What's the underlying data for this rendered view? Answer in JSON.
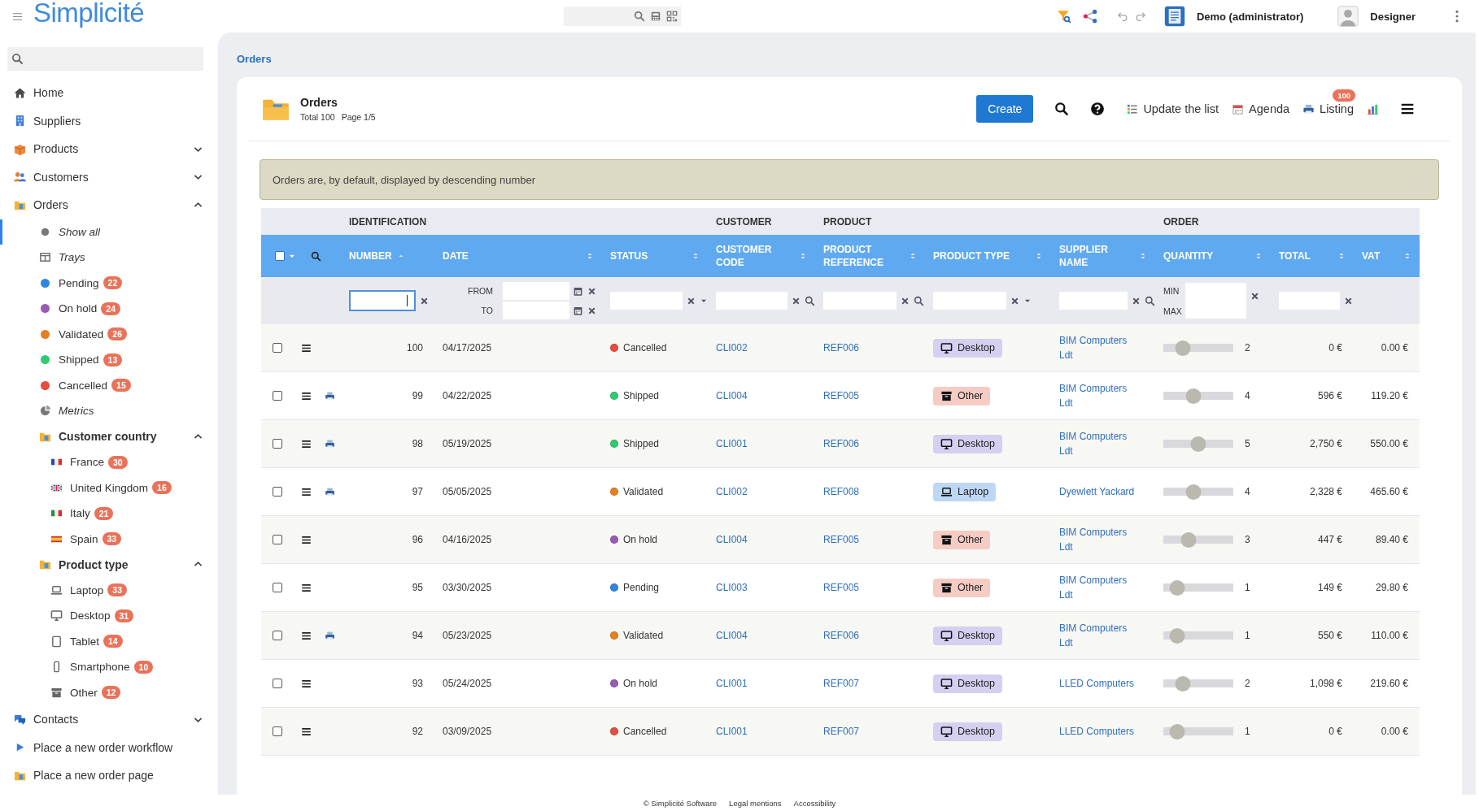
{
  "header": {
    "logo": "Simplicité",
    "user_role": "Demo (administrator)",
    "user_name": "Designer"
  },
  "sidebar": {
    "items": [
      {
        "label": "Home",
        "kind": "link",
        "selected": false
      },
      {
        "label": "Suppliers",
        "kind": "link",
        "selected": false
      },
      {
        "label": "Products",
        "kind": "link",
        "selected": false,
        "expanded": false
      },
      {
        "label": "Customers",
        "kind": "link",
        "selected": false,
        "expanded": false
      },
      {
        "label": "Orders",
        "kind": "link",
        "selected": false,
        "expanded": true,
        "children": [
          {
            "label": "Show all",
            "kind": "view",
            "selected": true
          },
          {
            "label": "Trays",
            "kind": "view",
            "selected": false
          },
          {
            "label": "Pending",
            "kind": "status",
            "selected": false,
            "color": "#2e86de",
            "count": "22"
          },
          {
            "label": "On hold",
            "kind": "status",
            "selected": false,
            "color": "#9b59b6",
            "count": "24"
          },
          {
            "label": "Validated",
            "kind": "status",
            "selected": false,
            "color": "#e67e22",
            "count": "26"
          },
          {
            "label": "Shipped",
            "kind": "status",
            "selected": false,
            "color": "#2ecc71",
            "count": "13"
          },
          {
            "label": "Cancelled",
            "kind": "status",
            "selected": false,
            "color": "#e74c3c",
            "count": "15"
          },
          {
            "label": "Metrics",
            "kind": "view",
            "selected": false
          },
          {
            "label": "Customer country",
            "kind": "group",
            "selected": false,
            "expanded": true,
            "children": [
              {
                "label": "France",
                "kind": "flag",
                "selected": false,
                "count": "30"
              },
              {
                "label": "United Kingdom",
                "kind": "flag",
                "selected": false,
                "count": "16"
              },
              {
                "label": "Italy",
                "kind": "flag",
                "selected": false,
                "count": "21"
              },
              {
                "label": "Spain",
                "kind": "flag",
                "selected": false,
                "count": "33"
              }
            ]
          },
          {
            "label": "Product type",
            "kind": "group",
            "selected": false,
            "expanded": true,
            "children": [
              {
                "label": "Laptop",
                "kind": "device",
                "selected": false,
                "count": "33"
              },
              {
                "label": "Desktop",
                "kind": "device",
                "selected": false,
                "count": "31"
              },
              {
                "label": "Tablet",
                "kind": "device",
                "selected": false,
                "count": "14"
              },
              {
                "label": "Smartphone",
                "kind": "device",
                "selected": false,
                "count": "10"
              },
              {
                "label": "Other",
                "kind": "device",
                "selected": false,
                "count": "12"
              }
            ]
          }
        ]
      },
      {
        "label": "Contacts",
        "kind": "link",
        "selected": false,
        "expanded": false
      },
      {
        "label": "Place a new order workflow",
        "kind": "link",
        "selected": false
      },
      {
        "label": "Place a new order page",
        "kind": "link",
        "selected": false
      }
    ]
  },
  "breadcrumb": "Orders",
  "list": {
    "title": "Orders",
    "total": "Total 100",
    "page": "Page 1/5",
    "actions": {
      "create": "Create",
      "update": "Update the list",
      "agenda": "Agenda",
      "listing": "Listing",
      "listing_badge": "100"
    },
    "notice": "Orders are, by default, displayed by descending number",
    "select_all": {
      "checked": false
    },
    "groups": [
      {
        "label": "IDENTIFICATION"
      },
      {
        "label": "CUSTOMER"
      },
      {
        "label": "PRODUCT"
      },
      {
        "label": "ORDER"
      }
    ],
    "columns": [
      {
        "label": "NUMBER",
        "sorted": true
      },
      {
        "label": "DATE",
        "sorted": false
      },
      {
        "label": "STATUS",
        "sorted": false
      },
      {
        "label": "CUSTOMER CODE",
        "sorted": false
      },
      {
        "label": "PRODUCT REFERENCE",
        "sorted": false
      },
      {
        "label": "PRODUCT TYPE",
        "sorted": false
      },
      {
        "label": "SUPPLIER NAME",
        "sorted": false
      },
      {
        "label": "QUANTITY",
        "sorted": false
      },
      {
        "label": "TOTAL",
        "sorted": false
      },
      {
        "label": "VAT",
        "sorted": false
      }
    ],
    "filters": [
      {
        "kind": "text",
        "focused": true
      },
      {
        "kind": "date-range",
        "from_label": "FROM",
        "to_label": "TO"
      },
      {
        "kind": "select"
      },
      {
        "kind": "lookup"
      },
      {
        "kind": "lookup"
      },
      {
        "kind": "select"
      },
      {
        "kind": "lookup"
      },
      {
        "kind": "range",
        "min_label": "MIN",
        "max_label": "MAX"
      },
      {
        "kind": "text",
        "focused": false
      },
      {
        "kind": "none"
      }
    ],
    "rows": [
      {
        "checked": false,
        "printable": false,
        "number": "100",
        "date": "04/17/2025",
        "status": {
          "label": "Cancelled",
          "color": "#e74c3c"
        },
        "customer": "CLI002",
        "product": "REF006",
        "type": {
          "label": "Desktop",
          "kind": "desktop",
          "color": "#d5cff0"
        },
        "supplier": "BIM Computers Ldt",
        "level": 0.28,
        "quantity": "2",
        "total": "0 €",
        "vat": "0.00 €"
      },
      {
        "checked": false,
        "printable": true,
        "number": "99",
        "date": "04/22/2025",
        "status": {
          "label": "Shipped",
          "color": "#2ecc71"
        },
        "customer": "CLI004",
        "product": "REF005",
        "type": {
          "label": "Other",
          "kind": "other",
          "color": "#f5cbc3"
        },
        "supplier": "BIM Computers Ldt",
        "level": 0.43,
        "quantity": "4",
        "total": "596 €",
        "vat": "119.20 €"
      },
      {
        "checked": false,
        "printable": true,
        "number": "98",
        "date": "05/19/2025",
        "status": {
          "label": "Shipped",
          "color": "#2ecc71"
        },
        "customer": "CLI001",
        "product": "REF006",
        "type": {
          "label": "Desktop",
          "kind": "desktop",
          "color": "#d5cff0"
        },
        "supplier": "BIM Computers Ldt",
        "level": 0.5,
        "quantity": "5",
        "total": "2,750 €",
        "vat": "550.00 €"
      },
      {
        "checked": false,
        "printable": true,
        "number": "97",
        "date": "05/05/2025",
        "status": {
          "label": "Validated",
          "color": "#e67e22"
        },
        "customer": "CLI002",
        "product": "REF008",
        "type": {
          "label": "Laptop",
          "kind": "laptop",
          "color": "#bdd7f5"
        },
        "supplier": "Dyewlett Yackard",
        "level": 0.43,
        "quantity": "4",
        "total": "2,328 €",
        "vat": "465.60 €"
      },
      {
        "checked": false,
        "printable": false,
        "number": "96",
        "date": "04/16/2025",
        "status": {
          "label": "On hold",
          "color": "#9b59b6"
        },
        "customer": "CLI004",
        "product": "REF005",
        "type": {
          "label": "Other",
          "kind": "other",
          "color": "#f5cbc3"
        },
        "supplier": "BIM Computers Ldt",
        "level": 0.36,
        "quantity": "3",
        "total": "447 €",
        "vat": "89.40 €"
      },
      {
        "checked": false,
        "printable": false,
        "number": "95",
        "date": "03/30/2025",
        "status": {
          "label": "Pending",
          "color": "#2e86de"
        },
        "customer": "CLI003",
        "product": "REF005",
        "type": {
          "label": "Other",
          "kind": "other",
          "color": "#f5cbc3"
        },
        "supplier": "BIM Computers Ldt",
        "level": 0.2,
        "quantity": "1",
        "total": "149 €",
        "vat": "29.80 €"
      },
      {
        "checked": false,
        "printable": true,
        "number": "94",
        "date": "05/23/2025",
        "status": {
          "label": "Validated",
          "color": "#e67e22"
        },
        "customer": "CLI004",
        "product": "REF006",
        "type": {
          "label": "Desktop",
          "kind": "desktop",
          "color": "#d5cff0"
        },
        "supplier": "BIM Computers Ldt",
        "level": 0.2,
        "quantity": "1",
        "total": "550 €",
        "vat": "110.00 €"
      },
      {
        "checked": false,
        "printable": false,
        "number": "93",
        "date": "05/24/2025",
        "status": {
          "label": "On hold",
          "color": "#9b59b6"
        },
        "customer": "CLI001",
        "product": "REF007",
        "type": {
          "label": "Desktop",
          "kind": "desktop",
          "color": "#d5cff0"
        },
        "supplier": "LLED Computers",
        "level": 0.28,
        "quantity": "2",
        "total": "1,098 €",
        "vat": "219.60 €"
      },
      {
        "checked": false,
        "printable": false,
        "number": "92",
        "date": "03/09/2025",
        "status": {
          "label": "Cancelled",
          "color": "#e74c3c"
        },
        "customer": "CLI001",
        "product": "REF007",
        "type": {
          "label": "Desktop",
          "kind": "desktop",
          "color": "#d5cff0"
        },
        "supplier": "LLED Computers",
        "level": 0.2,
        "quantity": "1",
        "total": "0 €",
        "vat": "0.00 €"
      }
    ]
  },
  "footer": [
    "© Simplicité Software",
    "Legal mentions",
    "Accessibility"
  ]
}
